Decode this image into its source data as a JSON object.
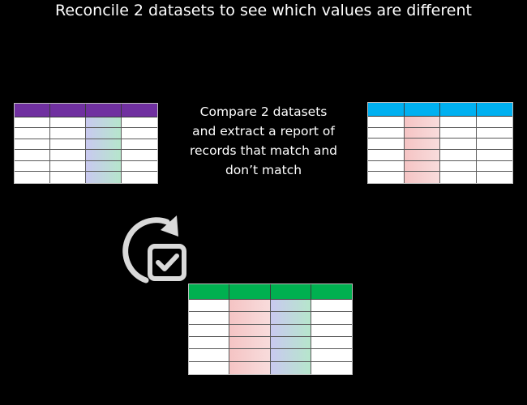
{
  "title": "Reconcile 2 datasets to see which values are different",
  "description": {
    "lines": [
      "Compare 2 datasets",
      "and extract a report of",
      "records that match and",
      "don’t match"
    ]
  },
  "colors": {
    "background": "#000000",
    "text": "#ffffff",
    "table_a_header": "#7030a0",
    "table_b_header": "#00b0f0",
    "result_header": "#00b050",
    "match_gradient": [
      "#c9c9f0",
      "#b6e6cc"
    ],
    "mismatch_gradient": [
      "#f5c4c4",
      "#f8dcdc"
    ],
    "icon": "#d9d9d9"
  },
  "tables": [
    {
      "id": "dataset-a-table",
      "columns": 4,
      "rows": 7,
      "header_color": "#7030a0",
      "highlight_columns": {
        "2": "match"
      }
    },
    {
      "id": "dataset-b-table",
      "columns": 4,
      "rows": 7,
      "header_color": "#00b0f0",
      "highlight_columns": {
        "1": "mismatch"
      }
    },
    {
      "id": "result-table",
      "columns": 4,
      "rows": 7,
      "header_color": "#00b050",
      "highlight_columns": {
        "1": "mismatch",
        "2": "match"
      }
    }
  ],
  "icon": {
    "name": "refresh-check-icon"
  }
}
